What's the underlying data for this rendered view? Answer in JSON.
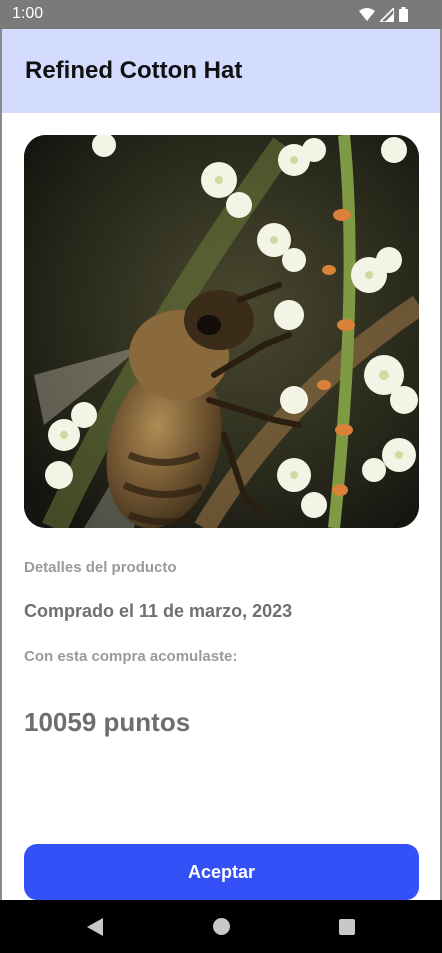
{
  "status_bar": {
    "time": "1:00",
    "icons": [
      "wifi-icon",
      "cell-signal-icon",
      "battery-icon"
    ]
  },
  "app_bar": {
    "title": "Refined Cotton Hat",
    "background": "#d3dcfe"
  },
  "product": {
    "image": "bee-on-white-flowers-photo",
    "details_label": "Detalles del producto",
    "purchase_date": "Comprado el 11 de marzo, 2023",
    "accumulated_label": "Con esta compra acomulaste:",
    "points": "10059 puntos"
  },
  "actions": {
    "accept_label": "Aceptar",
    "accent": "#3451f7"
  },
  "navigation": {
    "buttons": [
      "back-icon",
      "home-icon",
      "recents-icon"
    ]
  }
}
